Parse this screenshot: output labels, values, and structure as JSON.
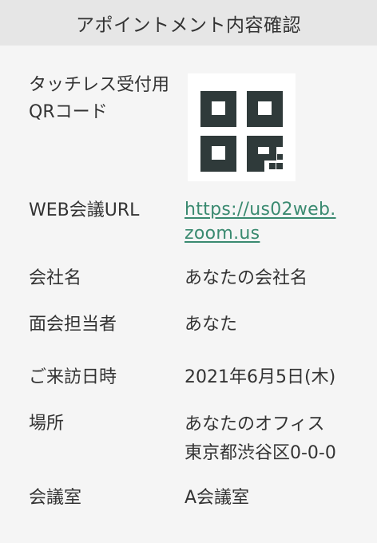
{
  "header": {
    "title": "アポイントメント内容確認"
  },
  "rows": {
    "qr": {
      "label_line1": "タッチレス受付用",
      "label_line2": "QRコード",
      "icon": "qr-code-icon"
    },
    "web_url": {
      "label": "WEB会議URL",
      "value_line1": "https://us02web.",
      "value_line2": "zoom.us"
    },
    "company": {
      "label": "会社名",
      "value": "あなたの会社名"
    },
    "contact": {
      "label": "面会担当者",
      "value": "あなた"
    },
    "datetime": {
      "label": "ご来訪日時",
      "value": "2021年6月5日(木)"
    },
    "place": {
      "label": "場所",
      "value_line1": "あなたのオフィス",
      "value_line2": "東京都渋谷区0-0-0"
    },
    "room": {
      "label": "会議室",
      "value": "A会議室"
    }
  },
  "colors": {
    "link": "#3a8a70",
    "qr_dark": "#2f3a3a",
    "header_bg": "#e6e6e6",
    "page_bg": "#f5f5f5"
  }
}
